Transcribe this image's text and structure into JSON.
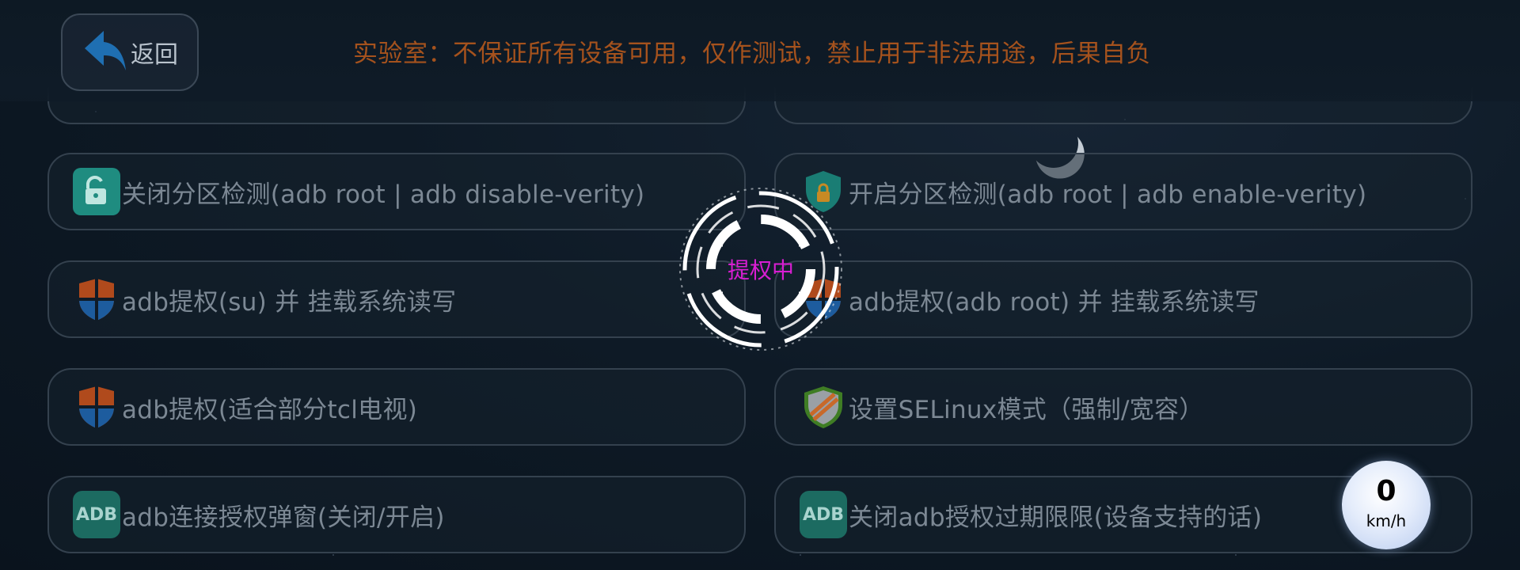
{
  "header": {
    "back_label": "返回",
    "notice": "实验室：不保证所有设备可用，仅作测试，禁止用于非法用途，后果自负"
  },
  "items": [
    {
      "label": "关闭分区检测(adb root | adb disable-verity)",
      "icon": "unlock-icon"
    },
    {
      "label": "开启分区检测(adb root | adb enable-verity)",
      "icon": "shield-lock-icon"
    },
    {
      "label": "adb提权(su) 并 挂载系统读写",
      "icon": "shield-icon"
    },
    {
      "label": "adb提权(adb root) 并 挂载系统读写",
      "icon": "shield-icon"
    },
    {
      "label": "adb提权(适合部分tcl电视)",
      "icon": "shield-icon"
    },
    {
      "label": "设置SELinux模式（强制/宽容）",
      "icon": "selinux-shield-icon"
    },
    {
      "label": "adb连接授权弹窗(关闭/开启)",
      "icon": "adb-icon"
    },
    {
      "label": "关闭adb授权过期限限(设备支持的话)",
      "icon": "adb-icon"
    }
  ],
  "adb_icon_text": "ADB",
  "loading": {
    "text": "提权中"
  },
  "speed": {
    "value": "0",
    "unit": "km/h"
  },
  "colors": {
    "notice": "#a5521d",
    "loading_text": "#d81ed2",
    "card_text": "#7c8894"
  }
}
